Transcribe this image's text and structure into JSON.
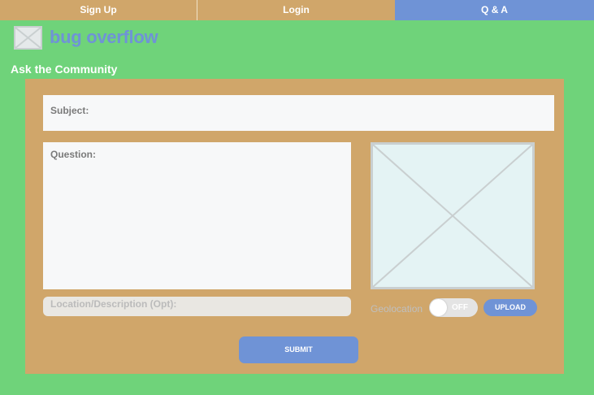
{
  "nav": {
    "tabs": [
      {
        "label": "Sign Up"
      },
      {
        "label": "Login"
      },
      {
        "label": "Q & A"
      }
    ],
    "active_color": "#6f93d6",
    "inactive_color": "#d0a66a"
  },
  "brand": {
    "name": "bug overflow",
    "logo_icon": "image-placeholder-icon"
  },
  "page": {
    "title": "Ask the Community"
  },
  "form": {
    "subject_label": "Subject:",
    "question_label": "Question:",
    "location_placeholder": "Location/Description (Opt):",
    "geolocation_label": "Geolocation",
    "geolocation_state": "OFF",
    "upload_label": "UPLOAD",
    "submit_label": "SUBMIT",
    "image_icon": "image-placeholder-icon"
  },
  "colors": {
    "background": "#6fd37a",
    "panel": "#d0a66a",
    "accent": "#6f93d6"
  }
}
